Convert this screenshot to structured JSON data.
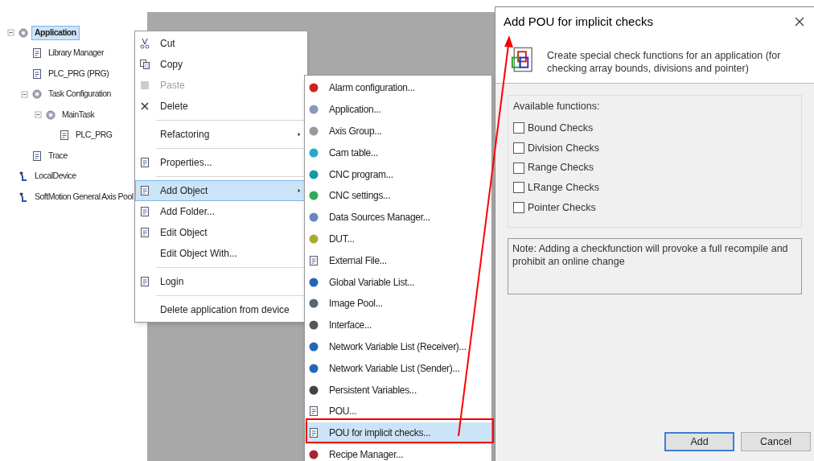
{
  "tree": [
    {
      "label": "Application",
      "selected": true,
      "expanded": true,
      "children": [
        {
          "label": "Library Manager",
          "selected": false
        },
        {
          "label": "PLC_PRG (PRG)",
          "selected": false
        },
        {
          "label": "Task Configuration",
          "selected": false,
          "expanded": true,
          "children": [
            {
              "label": "MainTask",
              "selected": false,
              "expanded": true,
              "children": [
                {
                  "label": "PLC_PRG",
                  "selected": false
                }
              ]
            }
          ]
        },
        {
          "label": "Trace",
          "selected": false
        }
      ]
    },
    {
      "label": "LocalDevice",
      "selected": false
    },
    {
      "label": "SoftMotion General Axis Pool",
      "selected": false
    }
  ],
  "context_menu": [
    {
      "kind": "item",
      "label": "Cut",
      "icon": true,
      "disabled": false,
      "selected": false
    },
    {
      "kind": "item",
      "label": "Copy",
      "icon": true,
      "disabled": false,
      "selected": false
    },
    {
      "kind": "item",
      "label": "Paste",
      "icon": true,
      "disabled": true,
      "selected": false
    },
    {
      "kind": "item",
      "label": "Delete",
      "icon": true,
      "disabled": false,
      "selected": false
    },
    {
      "kind": "separator"
    },
    {
      "kind": "submenu",
      "label": "Refactoring",
      "icon": false,
      "disabled": false,
      "selected": false
    },
    {
      "kind": "separator"
    },
    {
      "kind": "item",
      "label": "Properties...",
      "icon": true,
      "disabled": false,
      "selected": false
    },
    {
      "kind": "separator"
    },
    {
      "kind": "submenu",
      "label": "Add Object",
      "icon": true,
      "disabled": false,
      "selected": true
    },
    {
      "kind": "item",
      "label": "Add Folder...",
      "icon": true,
      "disabled": false,
      "selected": false
    },
    {
      "kind": "item",
      "label": "Edit Object",
      "icon": true,
      "disabled": false,
      "selected": false
    },
    {
      "kind": "item",
      "label": "Edit Object With...",
      "icon": false,
      "disabled": false,
      "selected": false
    },
    {
      "kind": "separator"
    },
    {
      "kind": "item",
      "label": "Login",
      "icon": true,
      "disabled": false,
      "selected": false
    },
    {
      "kind": "separator"
    },
    {
      "kind": "item",
      "label": "Delete application from device",
      "icon": false,
      "disabled": false,
      "selected": false
    }
  ],
  "submenu": [
    {
      "label": "Alarm configuration...",
      "selected": false
    },
    {
      "label": "Application...",
      "selected": false
    },
    {
      "label": "Axis Group...",
      "selected": false
    },
    {
      "label": "Cam table...",
      "selected": false
    },
    {
      "label": "CNC program...",
      "selected": false
    },
    {
      "label": "CNC settings...",
      "selected": false
    },
    {
      "label": "Data Sources Manager...",
      "selected": false
    },
    {
      "label": "DUT...",
      "selected": false
    },
    {
      "label": "External File...",
      "selected": false
    },
    {
      "label": "Global Variable List...",
      "selected": false
    },
    {
      "label": "Image Pool...",
      "selected": false
    },
    {
      "label": "Interface...",
      "selected": false
    },
    {
      "label": "Network Variable List (Receiver)...",
      "selected": false
    },
    {
      "label": "Network Variable List (Sender)...",
      "selected": false
    },
    {
      "label": "Persistent Variables...",
      "selected": false
    },
    {
      "label": "POU...",
      "selected": false
    },
    {
      "label": "POU for implicit checks...",
      "selected": true
    },
    {
      "label": "Recipe Manager...",
      "selected": false
    }
  ],
  "dialog": {
    "title": "Add POU for implicit checks",
    "description": "Create special check functions for an application (for checking array bounds, divisions and pointer)",
    "group_label": "Available functions:",
    "functions": [
      {
        "label": "Bound Checks",
        "checked": false
      },
      {
        "label": "Division Checks",
        "checked": false
      },
      {
        "label": "Range Checks",
        "checked": false
      },
      {
        "label": "LRange Checks",
        "checked": false
      },
      {
        "label": "Pointer Checks",
        "checked": false
      }
    ],
    "note": "Note: Adding a checkfunction will provoke a full recompile and prohibit an online change",
    "buttons": [
      "Add",
      "Cancel"
    ]
  }
}
